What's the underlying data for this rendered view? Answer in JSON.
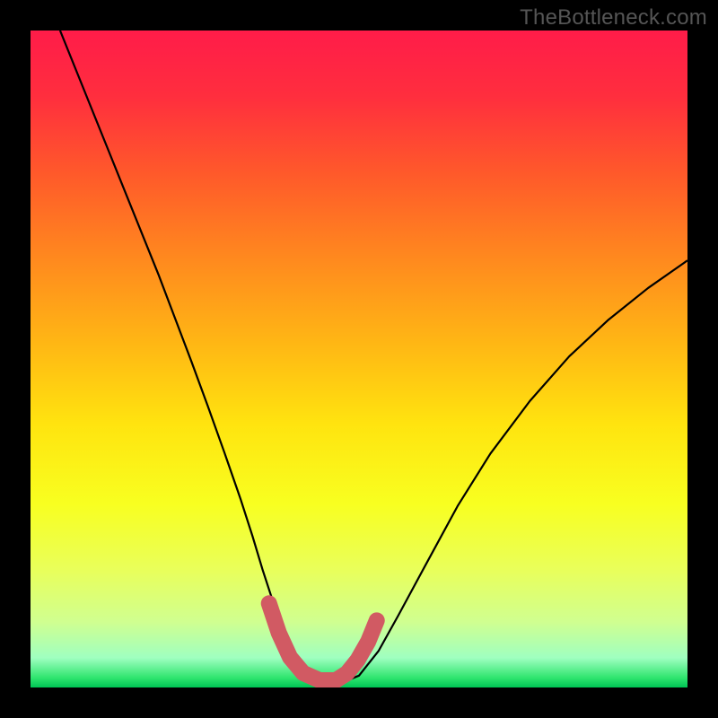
{
  "watermark": "TheBottleneck.com",
  "chart_data": {
    "type": "line",
    "title": "",
    "xlabel": "",
    "ylabel": "",
    "xlim": [
      0,
      1
    ],
    "ylim": [
      0,
      1
    ],
    "background_gradient": {
      "stops": [
        {
          "offset": 0.0,
          "color": "#ff1c49"
        },
        {
          "offset": 0.1,
          "color": "#ff2e3e"
        },
        {
          "offset": 0.22,
          "color": "#ff5a2a"
        },
        {
          "offset": 0.35,
          "color": "#ff8a1e"
        },
        {
          "offset": 0.48,
          "color": "#ffb814"
        },
        {
          "offset": 0.6,
          "color": "#ffe40f"
        },
        {
          "offset": 0.72,
          "color": "#f8ff20"
        },
        {
          "offset": 0.82,
          "color": "#e9ff5a"
        },
        {
          "offset": 0.9,
          "color": "#d0ff90"
        },
        {
          "offset": 0.955,
          "color": "#9fffc0"
        },
        {
          "offset": 0.985,
          "color": "#30e56f"
        },
        {
          "offset": 1.0,
          "color": "#00c455"
        }
      ]
    },
    "series": [
      {
        "name": "bottleneck-curve",
        "stroke": "#000000",
        "stroke_width": 2.2,
        "x": [
          0.045,
          0.07,
          0.095,
          0.12,
          0.145,
          0.17,
          0.195,
          0.22,
          0.245,
          0.27,
          0.295,
          0.32,
          0.338,
          0.353,
          0.368,
          0.383,
          0.4,
          0.43,
          0.46,
          0.48,
          0.5,
          0.53,
          0.56,
          0.6,
          0.65,
          0.7,
          0.76,
          0.82,
          0.88,
          0.94,
          1.0
        ],
        "y": [
          1.0,
          0.938,
          0.876,
          0.814,
          0.752,
          0.69,
          0.628,
          0.562,
          0.496,
          0.428,
          0.358,
          0.286,
          0.23,
          0.18,
          0.134,
          0.092,
          0.054,
          0.018,
          0.01,
          0.01,
          0.018,
          0.056,
          0.11,
          0.184,
          0.276,
          0.356,
          0.436,
          0.504,
          0.56,
          0.608,
          0.65
        ]
      },
      {
        "name": "optimum-band",
        "stroke": "#d15a63",
        "stroke_width": 18,
        "linecap": "round",
        "x": [
          0.363,
          0.378,
          0.395,
          0.415,
          0.44,
          0.465,
          0.482,
          0.498,
          0.514,
          0.527
        ],
        "y": [
          0.128,
          0.083,
          0.046,
          0.022,
          0.011,
          0.011,
          0.022,
          0.042,
          0.07,
          0.102
        ]
      }
    ],
    "annotations": []
  }
}
